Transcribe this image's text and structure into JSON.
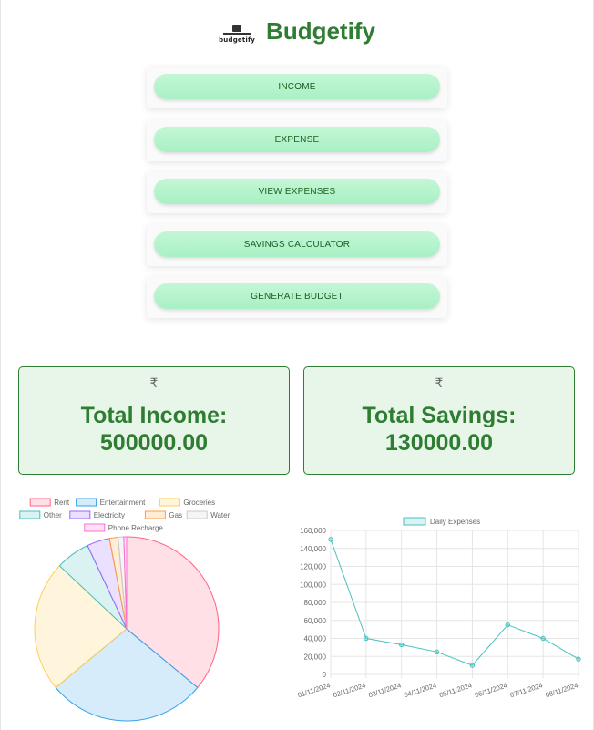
{
  "header": {
    "logo_text": "budgetify",
    "title": "Budgetify"
  },
  "menu": [
    {
      "label": "INCOME"
    },
    {
      "label": "EXPENSE"
    },
    {
      "label": "VIEW EXPENSES"
    },
    {
      "label": "SAVINGS CALCULATOR"
    },
    {
      "label": "GENERATE BUDGET"
    }
  ],
  "stats": {
    "income": {
      "currency": "₹",
      "label": "Total Income:",
      "value": "500000.00"
    },
    "savings": {
      "currency": "₹",
      "label": "Total Savings:",
      "value": "130000.00"
    }
  },
  "chart_data": [
    {
      "type": "pie",
      "categories": [
        "Rent",
        "Entertainment",
        "Groceries",
        "Other",
        "Electricity",
        "Gas",
        "Water",
        "Phone Recharge"
      ],
      "values": [
        36,
        28,
        23,
        6,
        4,
        1.5,
        1,
        0.5
      ],
      "colors": [
        "#ff6384",
        "#36a2eb",
        "#ffce56",
        "#4bc0c0",
        "#9966ff",
        "#ff9f40",
        "#c9cbcf",
        "#ff6fd1"
      ],
      "legend": "top"
    },
    {
      "type": "line",
      "series": [
        {
          "name": "Daily Expenses",
          "values": [
            150000,
            40000,
            33000,
            25000,
            10000,
            55000,
            40000,
            17000
          ]
        }
      ],
      "x": [
        "01/11/2024",
        "02/11/2024",
        "03/11/2024",
        "04/11/2024",
        "05/11/2024",
        "06/11/2024",
        "07/11/2024",
        "08/11/2024"
      ],
      "ylim": [
        0,
        160000
      ],
      "yticks": [
        0,
        20000,
        40000,
        60000,
        80000,
        100000,
        120000,
        140000,
        160000
      ],
      "ytick_labels": [
        "0",
        "20,000",
        "40,000",
        "60,000",
        "80,000",
        "100,000",
        "120,000",
        "140,000",
        "160,000"
      ],
      "color": "#4bc0c0",
      "grid": true,
      "legend": "top"
    }
  ]
}
